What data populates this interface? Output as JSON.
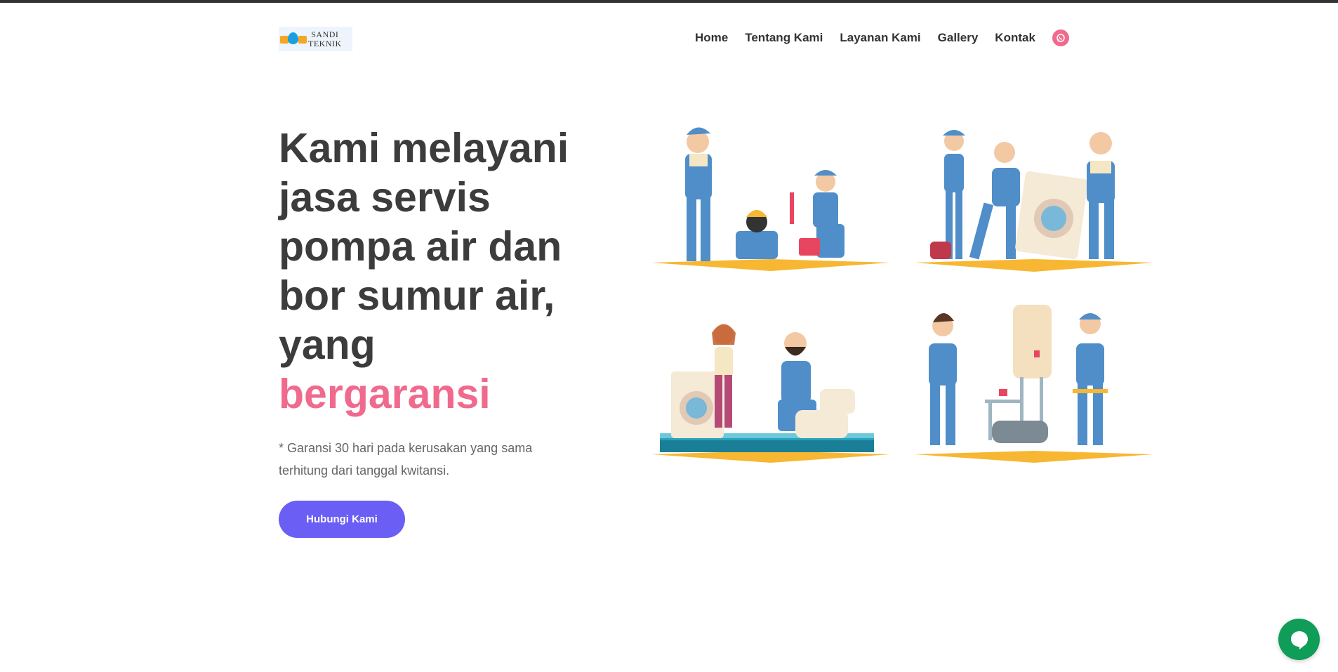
{
  "brand": {
    "logo_line1": "SANDI",
    "logo_line2": "TEKNIK"
  },
  "nav": {
    "items": [
      {
        "label": "Home"
      },
      {
        "label": "Tentang Kami"
      },
      {
        "label": "Layanan Kami"
      },
      {
        "label": "Gallery"
      },
      {
        "label": "Kontak"
      }
    ],
    "social_icon": "whatsapp-icon"
  },
  "hero": {
    "title_lines": [
      "Kami melayani",
      "jasa servis",
      "pompa air dan",
      "bor sumur air,",
      "yang"
    ],
    "title_accent": "bergaransi",
    "note": "* Garansi 30 hari pada kerusakan yang sama terhitung dari tanggal kwitansi.",
    "cta_label": "Hubungi Kami"
  },
  "illustrations": [
    {
      "name": "plumbers-team-illustration"
    },
    {
      "name": "washing-machine-repair-illustration"
    },
    {
      "name": "flooded-bathroom-illustration"
    },
    {
      "name": "water-heater-installation-illustration"
    }
  ],
  "chat_icon": "chat-bubble-icon",
  "colors": {
    "accent_pink": "#f06a8e",
    "button_purple": "#6a5ef5",
    "chat_green": "#0f9d58",
    "text_dark": "#3c3c3c"
  }
}
